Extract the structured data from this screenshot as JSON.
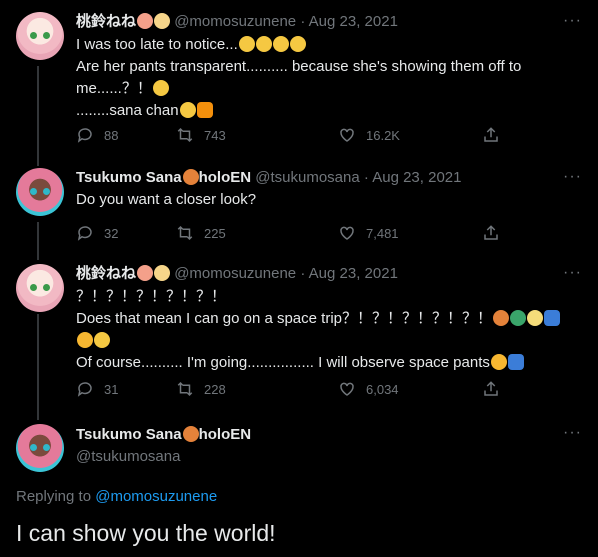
{
  "colors": {
    "background": "#000000",
    "text": "#e7e9ea",
    "muted": "#71767b",
    "link": "#1d9bf0",
    "line": "#333639"
  },
  "tweets": [
    {
      "name": "桃鈴ねね",
      "name_emojis": [
        "peach-emoji",
        "bun-emoji"
      ],
      "handle": "@momosuzunene",
      "dot": "·",
      "date": "Aug 23, 2021",
      "lines": [
        {
          "text": "I was too late to notice...",
          "emojis": [
            "relieved-face-emoji",
            "relieved-face-emoji",
            "relieved-face-emoji",
            "relieved-face-emoji"
          ]
        },
        {
          "text": "Are her pants transparent.......... because she's showing them off to",
          "emojis": []
        },
        {
          "text": "me......？！",
          "emojis": [
            "monocle-face-emoji"
          ]
        },
        {
          "text": "........sana chan",
          "emojis": [
            "winking-face-emoji",
            "orange-heart-emoji"
          ]
        }
      ],
      "replies": "88",
      "retweets": "743",
      "likes": "16.2K"
    },
    {
      "name": "Tsukumo Sana",
      "name_emojis": [
        "ringed-planet-emoji"
      ],
      "name_suffix": "holoEN",
      "handle": "@tsukumosana",
      "dot": "·",
      "date": "Aug 23, 2021",
      "lines": [
        {
          "text": "Do you want a closer look?",
          "emojis": []
        }
      ],
      "replies": "32",
      "retweets": "225",
      "likes": "7,481"
    },
    {
      "name": "桃鈴ねね",
      "name_emojis": [
        "peach-emoji",
        "bun-emoji"
      ],
      "handle": "@momosuzunene",
      "dot": "·",
      "date": "Aug 23, 2021",
      "lines": [
        {
          "text": "？！？！？！？！？！",
          "emojis": []
        },
        {
          "text": "Does that mean I can go on a space trip？！？！？！？！？！",
          "emojis": [
            "ringed-planet-emoji",
            "globe-emoji",
            "full-moon-emoji",
            "briefs-emoji"
          ]
        },
        {
          "text": "",
          "emojis": [
            "sun-emoji",
            "smiling-face-emoji"
          ]
        },
        {
          "text": "Of course.......... I'm going................ I will observe space pants",
          "emojis": [
            "sun-emoji",
            "briefs-emoji"
          ]
        }
      ],
      "replies": "31",
      "retweets": "228",
      "likes": "6,034"
    }
  ],
  "focus_tweet": {
    "name": "Tsukumo Sana",
    "name_emojis": [
      "ringed-planet-emoji"
    ],
    "name_suffix": "holoEN",
    "handle": "@tsukumosana",
    "replying_label": "Replying to",
    "replying_to": "@momosuzunene",
    "text": "I can show you the world!"
  },
  "more_label": "···"
}
